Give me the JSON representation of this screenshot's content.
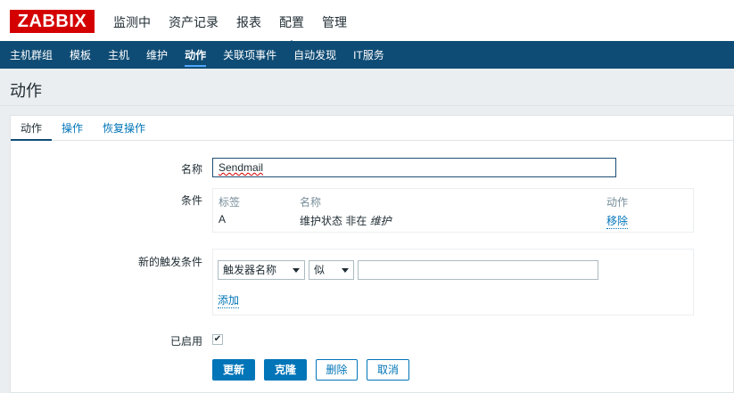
{
  "header": {
    "logo": "ZABBIX",
    "menu": [
      "监测中",
      "资产记录",
      "报表",
      "配置",
      "管理"
    ]
  },
  "subnav": [
    "主机群组",
    "模板",
    "主机",
    "维护",
    "动作",
    "关联项事件",
    "自动发现",
    "IT服务"
  ],
  "page_title": "动作",
  "tabs": [
    "动作",
    "操作",
    "恢复操作"
  ],
  "form": {
    "name_label": "名称",
    "name_value": "Sendmail",
    "conditions_label": "条件",
    "conditions_table": {
      "headers": [
        "标签",
        "名称",
        "动作"
      ],
      "rows": [
        {
          "tag": "A",
          "name": "维护状态 非在 ",
          "name_italic": "维护",
          "action": "移除"
        }
      ]
    },
    "new_condition_label": "新的触发条件",
    "condition_type": "触发器名称",
    "condition_operator": "似",
    "condition_value": "",
    "add_link": "添加",
    "enabled_label": "已启用",
    "enabled_check": "✔"
  },
  "buttons": {
    "update": "更新",
    "clone": "克隆",
    "delete": "删除",
    "cancel": "取消"
  },
  "colors": {
    "brand": "#d40000",
    "nav": "#0f4c75",
    "accent": "#0275b8"
  }
}
